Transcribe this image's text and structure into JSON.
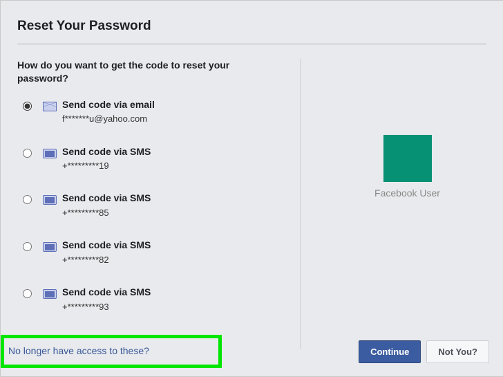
{
  "title": "Reset Your Password",
  "question": "How do you want to get the code to reset your password?",
  "options": [
    {
      "type": "email",
      "label": "Send code via email",
      "sub": "f*******u@yahoo.com",
      "checked": true
    },
    {
      "type": "sms",
      "label": "Send code via SMS",
      "sub": "+*********19",
      "checked": false
    },
    {
      "type": "sms",
      "label": "Send code via SMS",
      "sub": "+*********85",
      "checked": false
    },
    {
      "type": "sms",
      "label": "Send code via SMS",
      "sub": "+*********82",
      "checked": false
    },
    {
      "type": "sms",
      "label": "Send code via SMS",
      "sub": "+*********93",
      "checked": false
    }
  ],
  "user": {
    "name": "Facebook User"
  },
  "footer": {
    "no_access": "No longer have access to these?",
    "continue": "Continue",
    "not_you": "Not You?"
  }
}
